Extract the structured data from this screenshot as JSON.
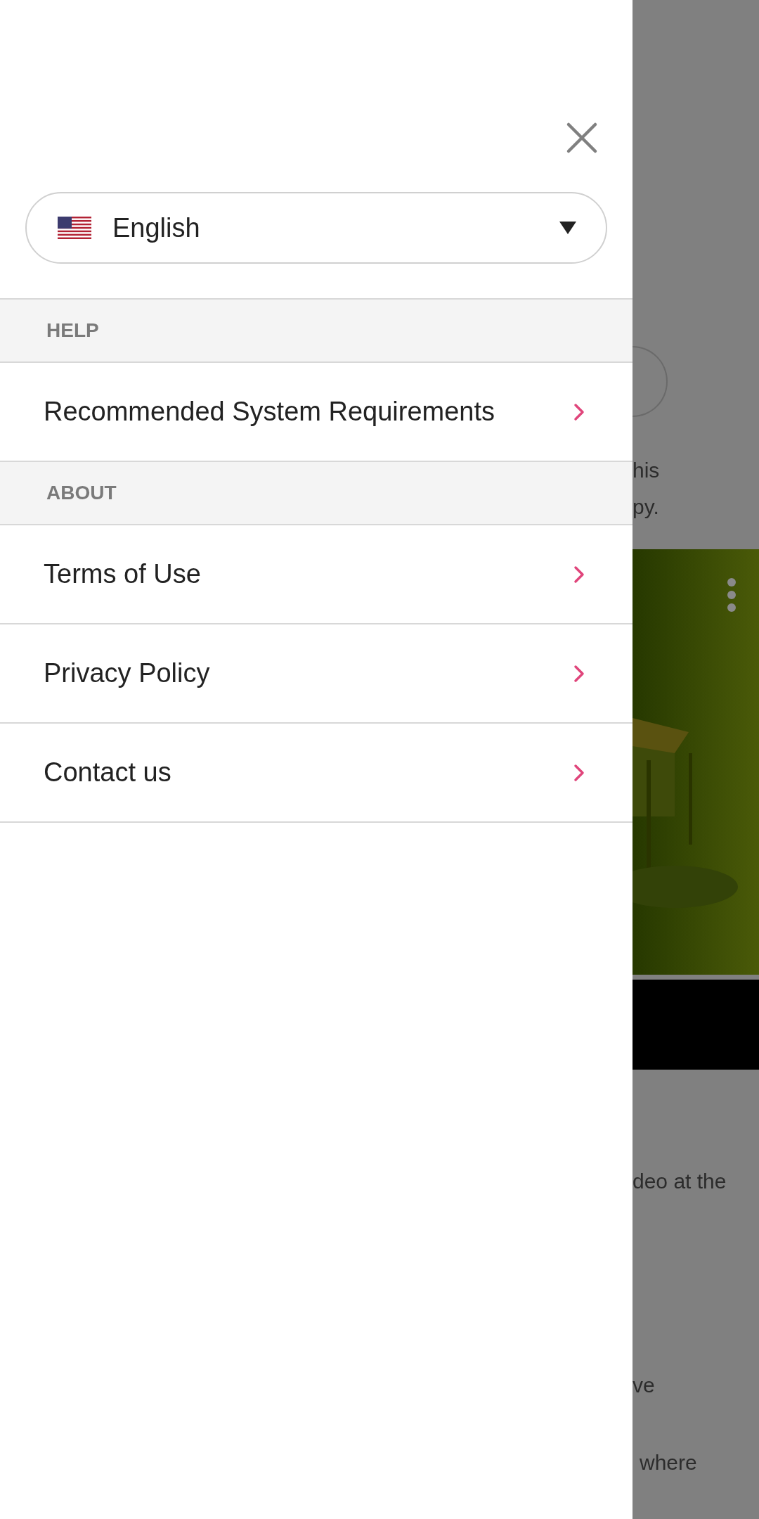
{
  "drawer": {
    "language": {
      "value": "English"
    },
    "sections": [
      {
        "heading": "HELP",
        "items": [
          "Recommended System Requirements"
        ]
      },
      {
        "heading": "ABOUT",
        "items": [
          "Terms of Use",
          "Privacy Policy",
          "Contact us"
        ]
      }
    ]
  },
  "background": {
    "lines_top": [
      "his",
      "py."
    ],
    "lines_bottom": [
      "deo at the",
      "ve",
      "where"
    ]
  }
}
